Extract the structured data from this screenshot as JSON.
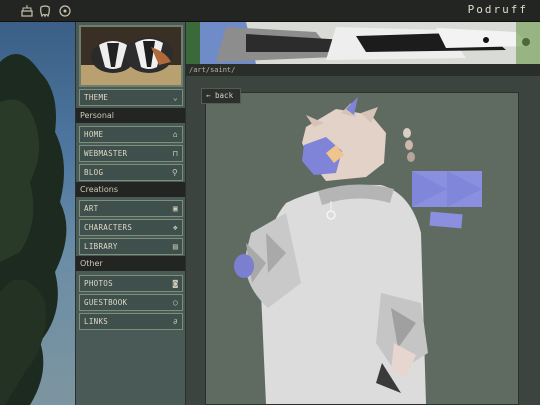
{
  "header": {
    "site_title": "Podruff",
    "icons": [
      "cake-icon",
      "tooth-icon",
      "compass-icon"
    ]
  },
  "sidebar": {
    "theme_label": "THEME",
    "sections": [
      {
        "title": "Personal",
        "items": [
          {
            "label": "HOME",
            "icon": "home-icon"
          },
          {
            "label": "WEBMASTER",
            "icon": "lock-icon"
          },
          {
            "label": "BLOG",
            "icon": "pin-icon"
          }
        ]
      },
      {
        "title": "Creations",
        "items": [
          {
            "label": "ART",
            "icon": "image-icon"
          },
          {
            "label": "CHARACTERS",
            "icon": "paw-icon"
          },
          {
            "label": "LIBRARY",
            "icon": "book-icon"
          }
        ]
      },
      {
        "title": "Other",
        "items": [
          {
            "label": "PHOTOS",
            "icon": "camera-icon"
          },
          {
            "label": "GUESTBOOK",
            "icon": "speech-icon"
          },
          {
            "label": "LINKS",
            "icon": "paperclip-icon"
          }
        ]
      }
    ]
  },
  "main": {
    "path": "/art/saint/",
    "back_label": "back"
  },
  "colors": {
    "topbar": "#232522",
    "sidebar": "#4a5a57",
    "button_border": "#7d8f7a",
    "artwork_bg": "#5f6b61",
    "character_accent": "#8a8fe0"
  }
}
